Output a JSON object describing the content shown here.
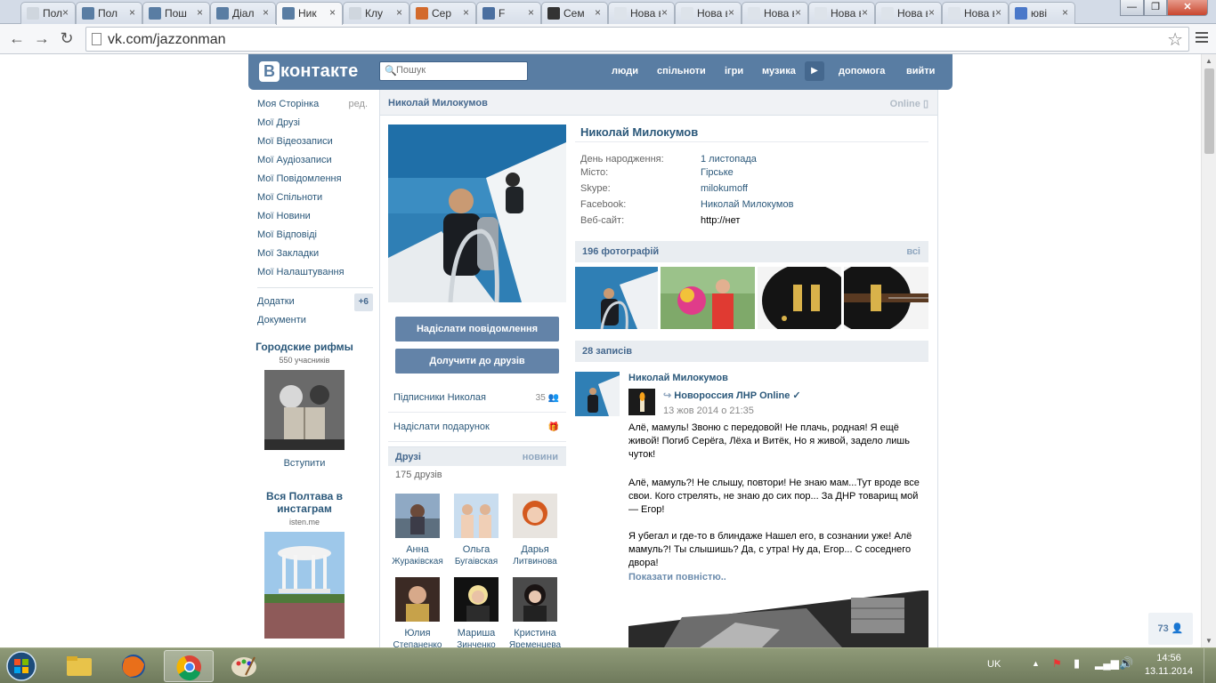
{
  "browser": {
    "tabs": [
      {
        "label": "Пол",
        "color": "#cfd6de",
        "active": false
      },
      {
        "label": "Пол",
        "color": "#597da3",
        "active": false
      },
      {
        "label": "Пош",
        "color": "#597da3",
        "active": false
      },
      {
        "label": "Діал",
        "color": "#597da3",
        "active": false
      },
      {
        "label": "Ник",
        "color": "#597da3",
        "active": true
      },
      {
        "label": "Клу",
        "color": "#cfd6de",
        "active": false
      },
      {
        "label": "Сер",
        "color": "#d36a2c",
        "active": false
      },
      {
        "label": "F",
        "color": "#4a6fa0",
        "active": false
      },
      {
        "label": "Сем",
        "color": "#333333",
        "active": false
      },
      {
        "label": "Нова в",
        "color": "#dde3ea",
        "active": false
      },
      {
        "label": "Нова в",
        "color": "#dde3ea",
        "active": false
      },
      {
        "label": "Нова в",
        "color": "#dde3ea",
        "active": false
      },
      {
        "label": "Нова в",
        "color": "#dde3ea",
        "active": false
      },
      {
        "label": "Нова в",
        "color": "#dde3ea",
        "active": false
      },
      {
        "label": "Нова в",
        "color": "#dde3ea",
        "active": false
      },
      {
        "label": "юві",
        "color": "#4a78c9",
        "active": false
      }
    ],
    "url": "vk.com/jazzonman"
  },
  "vk": {
    "logo_text": "контакте",
    "search_placeholder": "Пошук",
    "nav": [
      "люди",
      "спільноти",
      "ігри",
      "музика",
      "допомога",
      "вийти"
    ],
    "menu": [
      "Моя Сторінка",
      "Мої Друзі",
      "Мої Відеозаписи",
      "Мої Аудіозаписи",
      "Мої Повідомлення",
      "Мої Спільноти",
      "Мої Новини",
      "Мої Відповіді",
      "Мої Закладки",
      "Мої Налаштування"
    ],
    "menu_edit": "ред.",
    "menu_extra": [
      "Додатки",
      "Документи"
    ],
    "apps_badge": "+6",
    "promo1": {
      "title": "Городские рифмы",
      "sub": "550 учасників",
      "action": "Вступити"
    },
    "promo2": {
      "title": "Вся Полтава в инстаграм",
      "sub": "isten.me"
    },
    "header_name": "Николай Милокумов",
    "online": "Online",
    "profile": {
      "name": "Николай Милокумов",
      "info": [
        {
          "k": "День народження:",
          "v": "1 листопада"
        },
        {
          "k": "Місто:",
          "v": "Гірське"
        },
        {
          "k": "Skype:",
          "v": "milokumoff"
        },
        {
          "k": "Facebook:",
          "v": "Николай Милокумов"
        },
        {
          "k": "Веб-сайт:",
          "v": "http://нет"
        }
      ]
    },
    "buttons": {
      "message": "Надіслати повідомлення",
      "add_friend": "Долучити до друзів"
    },
    "followers": {
      "label": "Підписники Николая",
      "count": "35"
    },
    "gift": "Надіслати подарунок",
    "friends": {
      "title": "Друзі",
      "link": "новини",
      "count": "175 друзів",
      "list": [
        {
          "first": "Анна",
          "last": "Жураківская"
        },
        {
          "first": "Ольга",
          "last": "Бугаівская"
        },
        {
          "first": "Дарья",
          "last": "Литвинова"
        },
        {
          "first": "Юлия",
          "last": "Степаненко"
        },
        {
          "first": "Мариша",
          "last": "Зинченко"
        },
        {
          "first": "Кристина",
          "last": "Яременцева"
        }
      ]
    },
    "photos": {
      "title": "196 фотографій",
      "link": "всі"
    },
    "posts_title": "28 записів",
    "post": {
      "author": "Николай Милокумов",
      "repost_from": "Новороссия ЛНР Online ✓",
      "date": "13 жов 2014 о 21:35",
      "p1": "Алё, мамуль! Звоню с передовой! Не плачь, родная! Я ещё живой! Погиб Серёга, Лёха и Витёк, Но я живой, задело лишь чуток!",
      "p2": "Алё, мамуль?! Не слышу, повтори! Не знаю мам...Тут вроде все свои. Кого стрелять, не знаю до сих пор... За ДНР товарищ мой — Егор!",
      "p3": "Я убегал и где-то в блиндаже Нашел его, в сознании уже! Алё мамуль?! Ты слышишь? Да, с утра! Ну да, Егор... С соседнего двора!",
      "more": "Показати повністю.."
    },
    "side_counter": "73"
  },
  "taskbar": {
    "lang": "UK",
    "time": "14:56",
    "date": "13.11.2014"
  }
}
